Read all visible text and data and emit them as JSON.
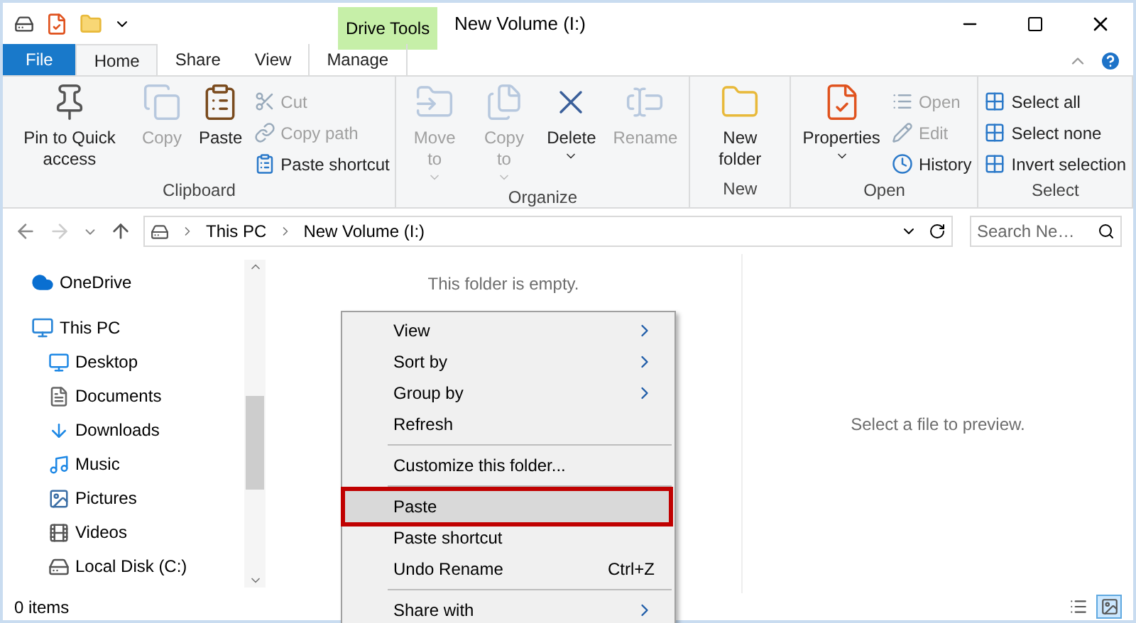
{
  "window": {
    "title": "New Volume (I:)"
  },
  "contextual_group": "Drive Tools",
  "tabs": [
    {
      "label": "File",
      "kind": "file",
      "selected": false
    },
    {
      "label": "Home",
      "kind": "normal",
      "selected": true
    },
    {
      "label": "Share",
      "kind": "normal",
      "selected": false
    },
    {
      "label": "View",
      "kind": "normal",
      "selected": false
    },
    {
      "label": "Manage",
      "kind": "contextual",
      "selected": false
    }
  ],
  "ribbon": [
    {
      "label": "Clipboard",
      "large": [
        {
          "label": "Pin to Quick access",
          "disabled": false,
          "dropdown": false
        },
        {
          "label": "Copy",
          "disabled": true,
          "dropdown": false
        },
        {
          "label": "Paste",
          "disabled": false,
          "dropdown": false
        }
      ],
      "small": [
        {
          "label": "Cut",
          "disabled": true
        },
        {
          "label": "Copy path",
          "disabled": true
        },
        {
          "label": "Paste shortcut",
          "disabled": false
        }
      ]
    },
    {
      "label": "Organize",
      "large": [
        {
          "label": "Move to",
          "disabled": true,
          "dropdown": true
        },
        {
          "label": "Copy to",
          "disabled": true,
          "dropdown": true
        },
        {
          "label": "Delete",
          "disabled": false,
          "dropdown": true
        },
        {
          "label": "Rename",
          "disabled": true,
          "dropdown": false
        }
      ]
    },
    {
      "label": "New",
      "large": [
        {
          "label": "New folder",
          "disabled": false,
          "dropdown": false
        }
      ]
    },
    {
      "label": "Open",
      "large": [
        {
          "label": "Properties",
          "disabled": false,
          "dropdown": true
        }
      ],
      "small": [
        {
          "label": "Open",
          "disabled": true
        },
        {
          "label": "Edit",
          "disabled": true
        },
        {
          "label": "History",
          "disabled": false
        }
      ]
    },
    {
      "label": "Select",
      "small": [
        {
          "label": "Select all",
          "disabled": false
        },
        {
          "label": "Select none",
          "disabled": false
        },
        {
          "label": "Invert selection",
          "disabled": false
        }
      ]
    }
  ],
  "address": {
    "path": [
      "This PC",
      "New Volume (I:)"
    ]
  },
  "search": {
    "placeholder": "Search Ne…"
  },
  "sidebar": {
    "items": [
      {
        "label": "OneDrive"
      },
      {
        "label": "This PC",
        "children": [
          {
            "label": "Desktop"
          },
          {
            "label": "Documents"
          },
          {
            "label": "Downloads"
          },
          {
            "label": "Music"
          },
          {
            "label": "Pictures"
          },
          {
            "label": "Videos"
          },
          {
            "label": "Local Disk (C:)"
          }
        ]
      }
    ]
  },
  "empty_message": "This folder is empty.",
  "preview_message": "Select a file to preview.",
  "context_menu": {
    "groups": [
      [
        {
          "label": "View",
          "submenu": true,
          "selected": false
        },
        {
          "label": "Sort by",
          "submenu": true,
          "selected": false
        },
        {
          "label": "Group by",
          "submenu": true,
          "selected": false
        },
        {
          "label": "Refresh",
          "submenu": false,
          "selected": false
        }
      ],
      [
        {
          "label": "Customize this folder...",
          "submenu": false,
          "selected": false
        }
      ],
      [
        {
          "label": "Paste",
          "submenu": false,
          "selected": true
        },
        {
          "label": "Paste shortcut",
          "submenu": false,
          "selected": false
        },
        {
          "label": "Undo Rename",
          "shortcut": "Ctrl+Z",
          "submenu": false,
          "selected": false
        }
      ],
      [
        {
          "label": "Share with",
          "submenu": true,
          "selected": false
        }
      ]
    ]
  },
  "status_bar": {
    "count": "0 items",
    "views": [
      {
        "selected": false
      },
      {
        "selected": true
      }
    ]
  }
}
